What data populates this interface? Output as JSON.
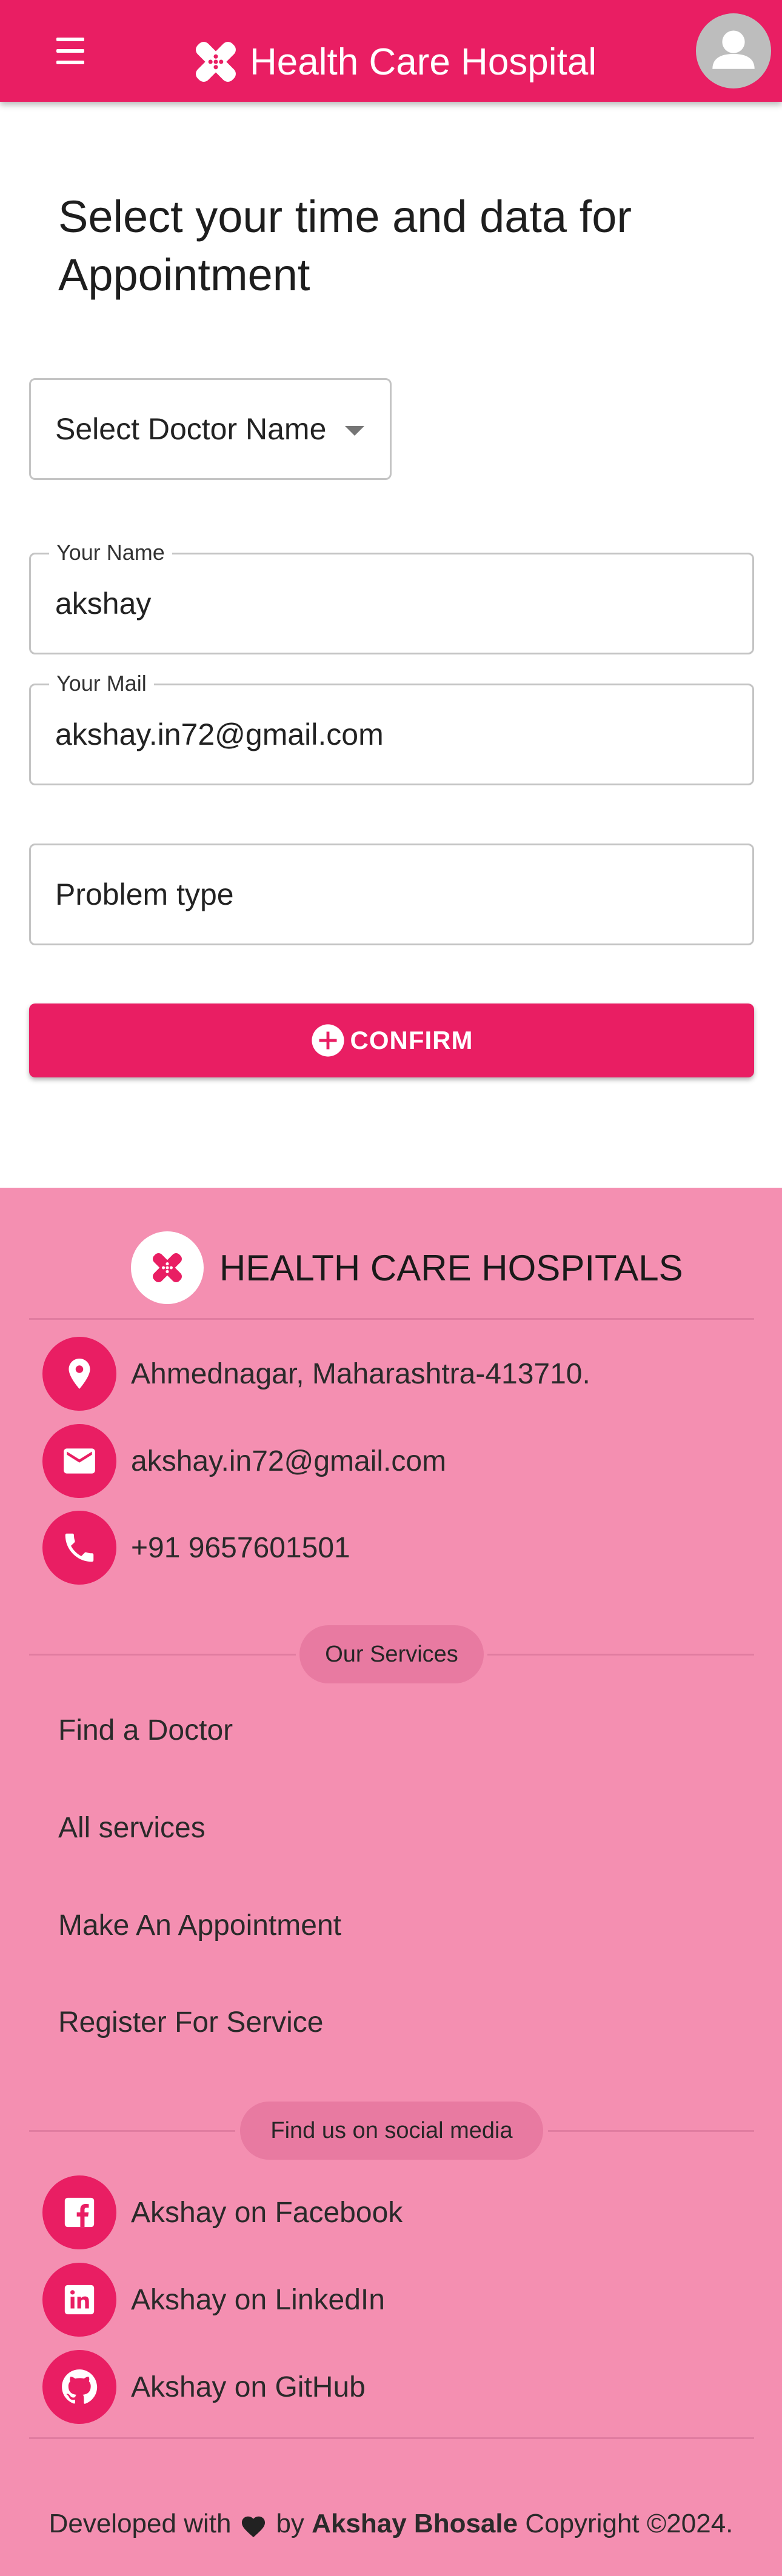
{
  "header": {
    "brand": "Health Care Hospital",
    "icons": {
      "menu": "menu-icon",
      "logo": "medical-logo-icon",
      "avatar": "account-circle-icon"
    },
    "color": "#e91e63"
  },
  "form": {
    "title": "Select your time and data for Appointment",
    "doctor_select": "Select Doctor Name",
    "name_legend": "Your Name",
    "name_value": "akshay",
    "mail_legend": "Your Mail",
    "mail_value": "akshay.in72@gmail.com",
    "problem_placeholder": "Problem type",
    "confirm_label": "CONFIRM",
    "confirm_icon": "add-circle-icon"
  },
  "footer": {
    "brand": "HEALTH CARE HOSPITALS",
    "background": "#f48fb1",
    "contacts": [
      {
        "icon": "location-pin-icon",
        "text": "Ahmednagar, Maharashtra-413710."
      },
      {
        "icon": "mail-icon",
        "text": "akshay.in72@gmail.com"
      },
      {
        "icon": "phone-icon",
        "text": "+91 9657601501"
      }
    ],
    "services_heading": "Our Services",
    "services": [
      "Find a Doctor",
      "All services",
      "Make An Appointment",
      "Register For Service"
    ],
    "social_heading": "Find us on social media",
    "social": [
      {
        "icon": "facebook-icon",
        "text": "Akshay on Facebook"
      },
      {
        "icon": "linkedin-icon",
        "text": "Akshay on LinkedIn"
      },
      {
        "icon": "github-icon",
        "text": "Akshay on GitHub"
      }
    ],
    "credit": {
      "prefix": "Developed with",
      "by": "by",
      "author": "Akshay Bhosale",
      "suffix": "Copyright ©2024."
    }
  }
}
